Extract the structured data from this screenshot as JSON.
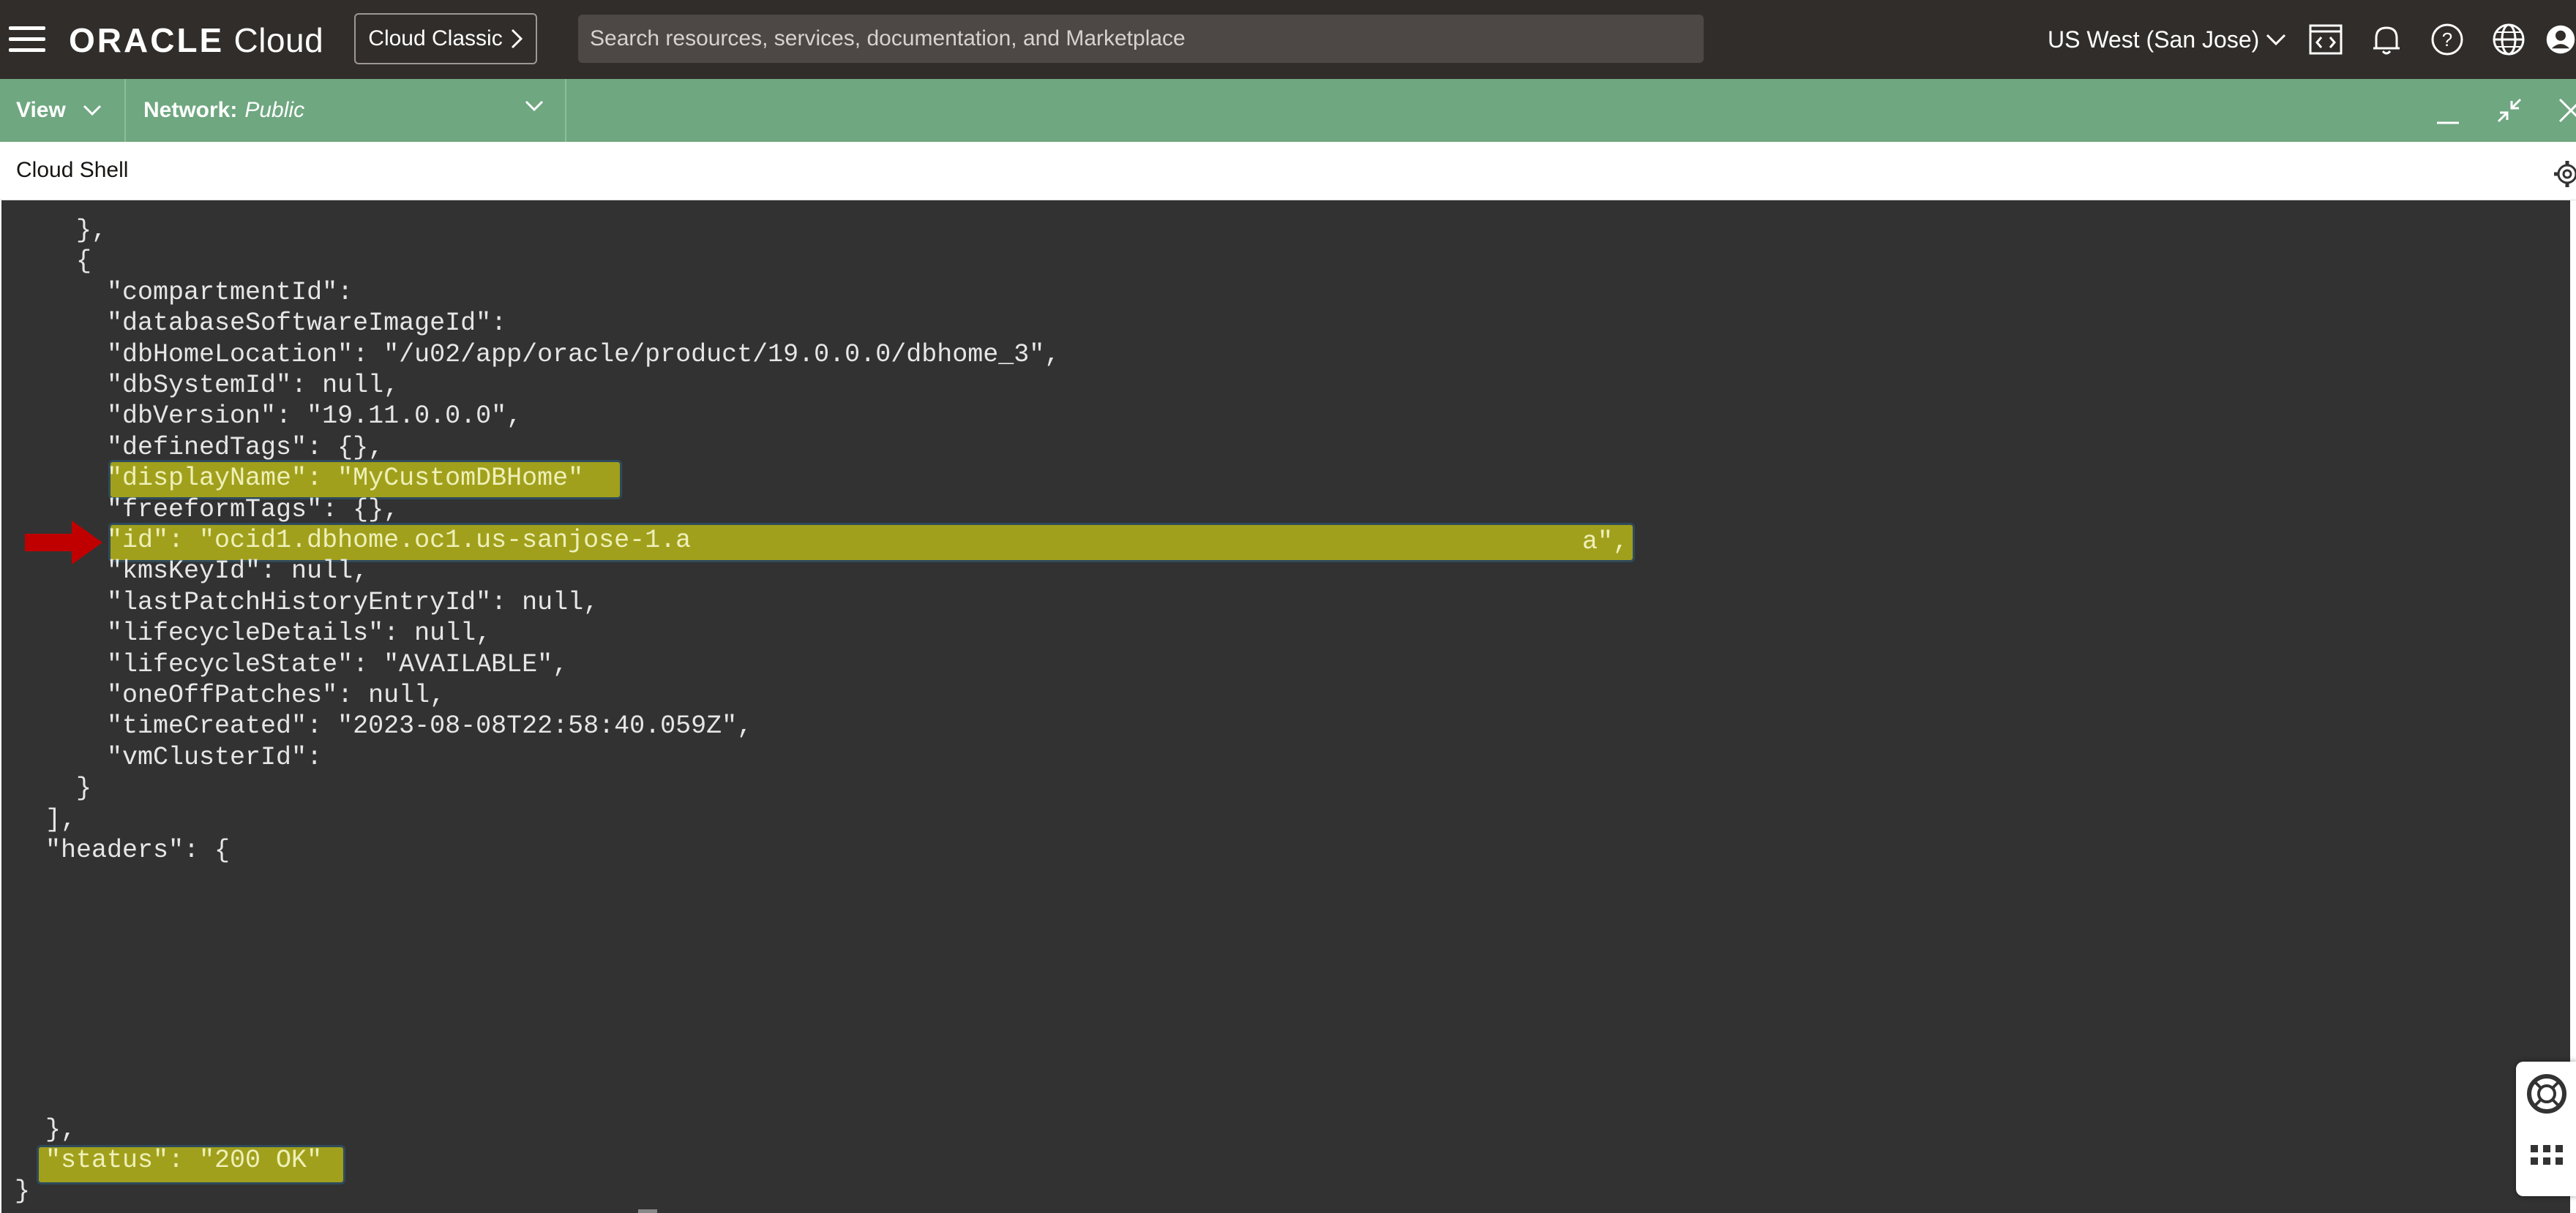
{
  "header": {
    "logo_brand": "ORACLE",
    "logo_product": "Cloud",
    "classic_button": "Cloud Classic",
    "search_placeholder": "Search resources, services, documentation, and Marketplace",
    "region": "US West (San Jose)",
    "icons": [
      "menu-icon",
      "code-editor-icon",
      "bell-icon",
      "help-icon",
      "globe-icon",
      "profile-icon"
    ]
  },
  "shell_toolbar": {
    "view_label": "View",
    "network_label": "Network:",
    "network_value": "Public",
    "icons": [
      "minimize-icon",
      "restore-icon",
      "close-icon"
    ]
  },
  "shell_title": "Cloud Shell",
  "terminal": {
    "lines": [
      "    },",
      "    {",
      "      \"compartmentId\":",
      "      \"databaseSoftwareImageId\":",
      "      \"dbHomeLocation\": \"/u02/app/oracle/product/19.0.0.0/dbhome_3\",",
      "      \"dbSystemId\": null,",
      "      \"dbVersion\": \"19.11.0.0.0\",",
      "      \"definedTags\": {},",
      "      \"displayName\": \"MyCustomDBHome\"",
      "      \"freeformTags\": {},",
      "      \"id\": \"ocid1.dbhome.oc1.us-sanjose-1.a",
      "      \"kmsKeyId\": null,",
      "      \"lastPatchHistoryEntryId\": null,",
      "      \"lifecycleDetails\": null,",
      "      \"lifecycleState\": \"AVAILABLE\",",
      "      \"oneOffPatches\": null,",
      "      \"timeCreated\": \"2023-08-08T22:58:40.059Z\",",
      "      \"vmClusterId\":",
      "    }",
      "  ],",
      "  \"headers\": {",
      "",
      "",
      "",
      "",
      "",
      "",
      "",
      "",
      "  },",
      "  \"status\": \"200 OK\"",
      "}"
    ],
    "id_suffix": "a\","
  },
  "colors": {
    "topbar": "#312d2a",
    "shell_toolbar": "#6fa780",
    "terminal_bg": "#323232",
    "highlight": "#a1a01c",
    "arrow": "#c00000"
  }
}
